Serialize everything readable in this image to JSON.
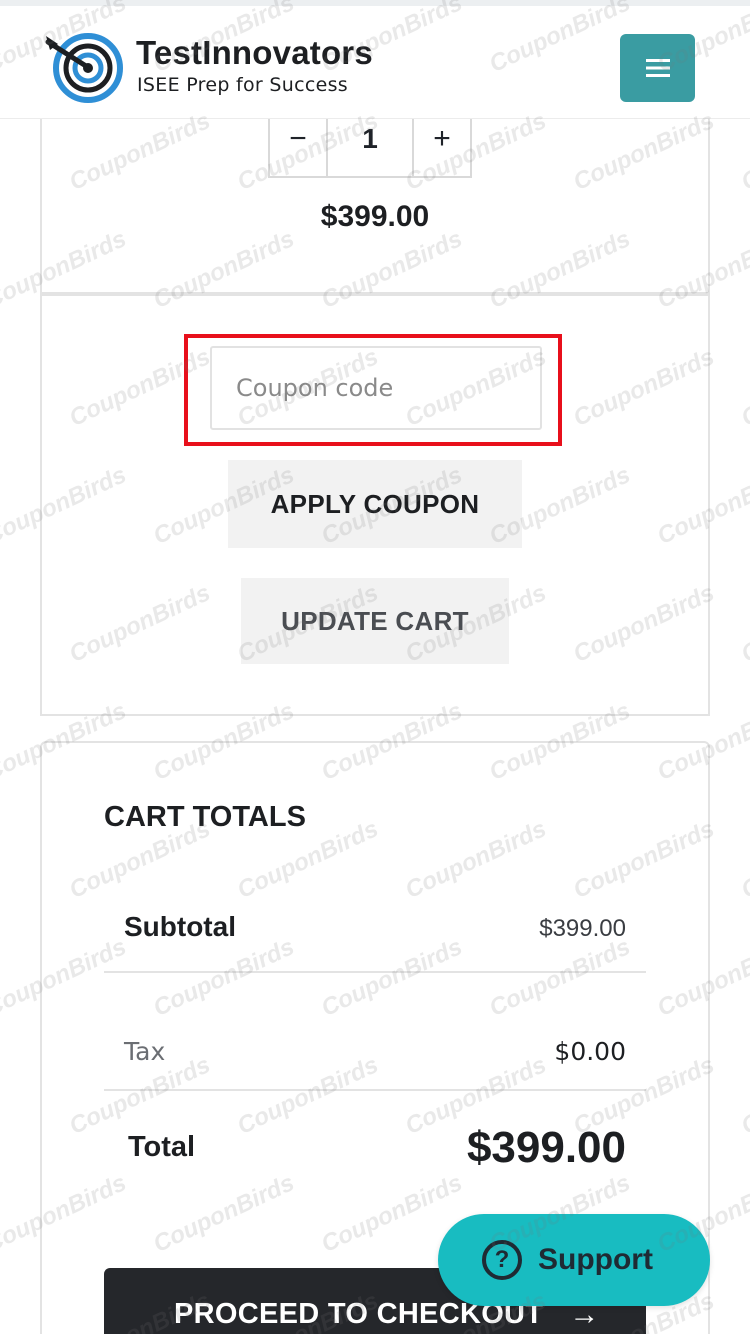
{
  "header": {
    "brand_name": "TestInnovators",
    "tagline": "ISEE Prep for Success",
    "menu_icon": "hamburger-icon",
    "accent_color": "#3a9ca2"
  },
  "cart_item": {
    "quantity": "1",
    "minus_symbol": "−",
    "plus_symbol": "+",
    "price": "$399.00"
  },
  "coupon": {
    "placeholder": "Coupon code",
    "apply_label": "APPLY COUPON",
    "update_label": "UPDATE CART",
    "highlight_color": "#e80f1b"
  },
  "totals": {
    "title": "CART TOTALS",
    "subtotal_label": "Subtotal",
    "subtotal_value": "$399.00",
    "tax_label": "Tax",
    "tax_value": "$0.00",
    "total_label": "Total",
    "total_value": "$399.00"
  },
  "checkout": {
    "label": "PROCEED TO CHECKOUT",
    "arrow": "→",
    "icon": "arrow-right-icon"
  },
  "support": {
    "label": "Support",
    "icon": "question-circle-icon",
    "icon_glyph": "?",
    "color": "#18bcc1"
  },
  "watermark": {
    "text": "CouponBirds"
  }
}
